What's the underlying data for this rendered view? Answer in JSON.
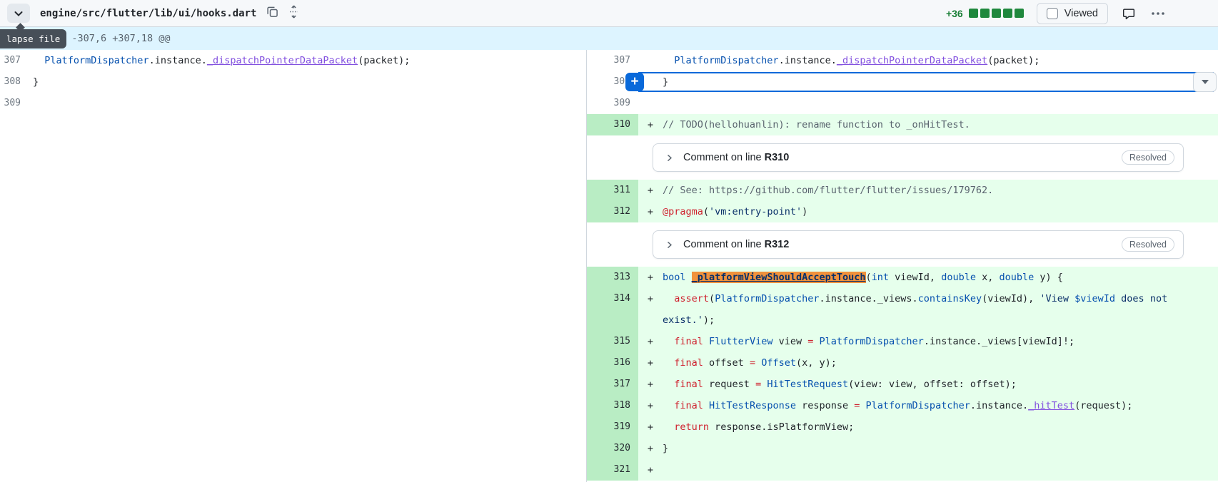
{
  "colors": {
    "accent_blue": "#0969da",
    "added_row_bg": "#e6ffec",
    "added_gutter_bg": "#b9edc4",
    "hunk_bg": "#ddf4ff",
    "diffstat_green": "#1f883d",
    "added_text_green": "#1a7f37",
    "search_highlight_orange": "#f0923c"
  },
  "file_header": {
    "path": "engine/src/flutter/lib/ui/hooks.dart",
    "diffstat_added": "+36",
    "diffstat_blocks": 5,
    "viewed_label": "Viewed",
    "collapse_tooltip": "lapse file"
  },
  "hunk": {
    "header": "@@ -307,6 +307,18 @@"
  },
  "left_lines": [
    {
      "num": "307",
      "segs": [
        {
          "t": "  ",
          "c": "p"
        },
        {
          "t": "PlatformDispatcher",
          "c": "t"
        },
        {
          "t": ".instance.",
          "c": "p"
        },
        {
          "t": "_dispatchPointerDataPacket",
          "c": "f"
        },
        {
          "t": "(packet);",
          "c": "p"
        }
      ]
    },
    {
      "num": "308",
      "segs": [
        {
          "t": "}",
          "c": "p"
        }
      ]
    },
    {
      "num": "309",
      "segs": []
    }
  ],
  "right_rows": [
    {
      "type": "context",
      "num": "307",
      "segs": [
        {
          "t": "  ",
          "c": "p"
        },
        {
          "t": "PlatformDispatcher",
          "c": "t"
        },
        {
          "t": ".instance.",
          "c": "p"
        },
        {
          "t": "_dispatchPointerDataPacket",
          "c": "f"
        },
        {
          "t": "(packet);",
          "c": "p"
        }
      ]
    },
    {
      "type": "selected",
      "num": "308",
      "add_button_label": "+",
      "segs": [
        {
          "t": "}",
          "c": "p"
        }
      ]
    },
    {
      "type": "context",
      "num": "309",
      "segs": []
    },
    {
      "type": "added",
      "num": "310",
      "marker": "+",
      "segs": [
        {
          "t": "// TODO(hellohuanlin): rename function to _onHitTest.",
          "c": "c"
        }
      ]
    },
    {
      "type": "comment",
      "prefix": "Comment on line ",
      "ref": "R310",
      "status": "Resolved"
    },
    {
      "type": "added",
      "num": "311",
      "marker": "+",
      "segs": [
        {
          "t": "// See: https://github.com/flutter/flutter/issues/179762.",
          "c": "c"
        }
      ]
    },
    {
      "type": "added",
      "num": "312",
      "marker": "+",
      "segs": [
        {
          "t": "@pragma",
          "c": "k"
        },
        {
          "t": "(",
          "c": "p"
        },
        {
          "t": "'vm:entry-point'",
          "c": "s"
        },
        {
          "t": ")",
          "c": "p"
        }
      ]
    },
    {
      "type": "comment",
      "prefix": "Comment on line ",
      "ref": "R312",
      "status": "Resolved"
    },
    {
      "type": "added",
      "num": "313",
      "marker": "+",
      "segs": [
        {
          "t": "bool",
          "c": "t"
        },
        {
          "t": " ",
          "c": "p"
        },
        {
          "t": "_platformViewShouldAcceptTouch",
          "c": "hl"
        },
        {
          "t": "(",
          "c": "p"
        },
        {
          "t": "int",
          "c": "t"
        },
        {
          "t": " viewId, ",
          "c": "p"
        },
        {
          "t": "double",
          "c": "t"
        },
        {
          "t": " x, ",
          "c": "p"
        },
        {
          "t": "double",
          "c": "t"
        },
        {
          "t": " y) {",
          "c": "p"
        }
      ]
    },
    {
      "type": "added",
      "num": "314",
      "wrap": true,
      "marker": "+",
      "segs": [
        {
          "t": "  ",
          "c": "p"
        },
        {
          "t": "assert",
          "c": "k"
        },
        {
          "t": "(",
          "c": "p"
        },
        {
          "t": "PlatformDispatcher",
          "c": "t"
        },
        {
          "t": ".instance._views.",
          "c": "p"
        },
        {
          "t": "containsKey",
          "c": "t"
        },
        {
          "t": "(viewId), ",
          "c": "p"
        },
        {
          "t": "'View ",
          "c": "s"
        },
        {
          "t": "$viewId",
          "c": "t"
        },
        {
          "t": " does not",
          "c": "s"
        },
        {
          "t": "\n",
          "c": "p"
        },
        {
          "t": "exist.'",
          "c": "s"
        },
        {
          "t": ");",
          "c": "p"
        }
      ]
    },
    {
      "type": "added",
      "num": "315",
      "marker": "+",
      "segs": [
        {
          "t": "  ",
          "c": "p"
        },
        {
          "t": "final",
          "c": "k"
        },
        {
          "t": " ",
          "c": "p"
        },
        {
          "t": "FlutterView",
          "c": "t"
        },
        {
          "t": " view ",
          "c": "p"
        },
        {
          "t": "=",
          "c": "k"
        },
        {
          "t": " ",
          "c": "p"
        },
        {
          "t": "PlatformDispatcher",
          "c": "t"
        },
        {
          "t": ".instance._views[viewId]!;",
          "c": "p"
        }
      ]
    },
    {
      "type": "added",
      "num": "316",
      "marker": "+",
      "segs": [
        {
          "t": "  ",
          "c": "p"
        },
        {
          "t": "final",
          "c": "k"
        },
        {
          "t": " offset ",
          "c": "p"
        },
        {
          "t": "=",
          "c": "k"
        },
        {
          "t": " ",
          "c": "p"
        },
        {
          "t": "Offset",
          "c": "t"
        },
        {
          "t": "(x, y);",
          "c": "p"
        }
      ]
    },
    {
      "type": "added",
      "num": "317",
      "marker": "+",
      "segs": [
        {
          "t": "  ",
          "c": "p"
        },
        {
          "t": "final",
          "c": "k"
        },
        {
          "t": " request ",
          "c": "p"
        },
        {
          "t": "=",
          "c": "k"
        },
        {
          "t": " ",
          "c": "p"
        },
        {
          "t": "HitTestRequest",
          "c": "t"
        },
        {
          "t": "(view: view, offset: offset);",
          "c": "p"
        }
      ]
    },
    {
      "type": "added",
      "num": "318",
      "marker": "+",
      "segs": [
        {
          "t": "  ",
          "c": "p"
        },
        {
          "t": "final",
          "c": "k"
        },
        {
          "t": " ",
          "c": "p"
        },
        {
          "t": "HitTestResponse",
          "c": "t"
        },
        {
          "t": " response ",
          "c": "p"
        },
        {
          "t": "=",
          "c": "k"
        },
        {
          "t": " ",
          "c": "p"
        },
        {
          "t": "PlatformDispatcher",
          "c": "t"
        },
        {
          "t": ".instance.",
          "c": "p"
        },
        {
          "t": "_hitTest",
          "c": "f"
        },
        {
          "t": "(request);",
          "c": "p"
        }
      ]
    },
    {
      "type": "added",
      "num": "319",
      "marker": "+",
      "segs": [
        {
          "t": "  ",
          "c": "p"
        },
        {
          "t": "return",
          "c": "k"
        },
        {
          "t": " response.isPlatformView;",
          "c": "p"
        }
      ]
    },
    {
      "type": "added",
      "num": "320",
      "marker": "+",
      "segs": [
        {
          "t": "}",
          "c": "p"
        }
      ]
    },
    {
      "type": "added",
      "num": "321",
      "marker": "+",
      "segs": []
    }
  ]
}
